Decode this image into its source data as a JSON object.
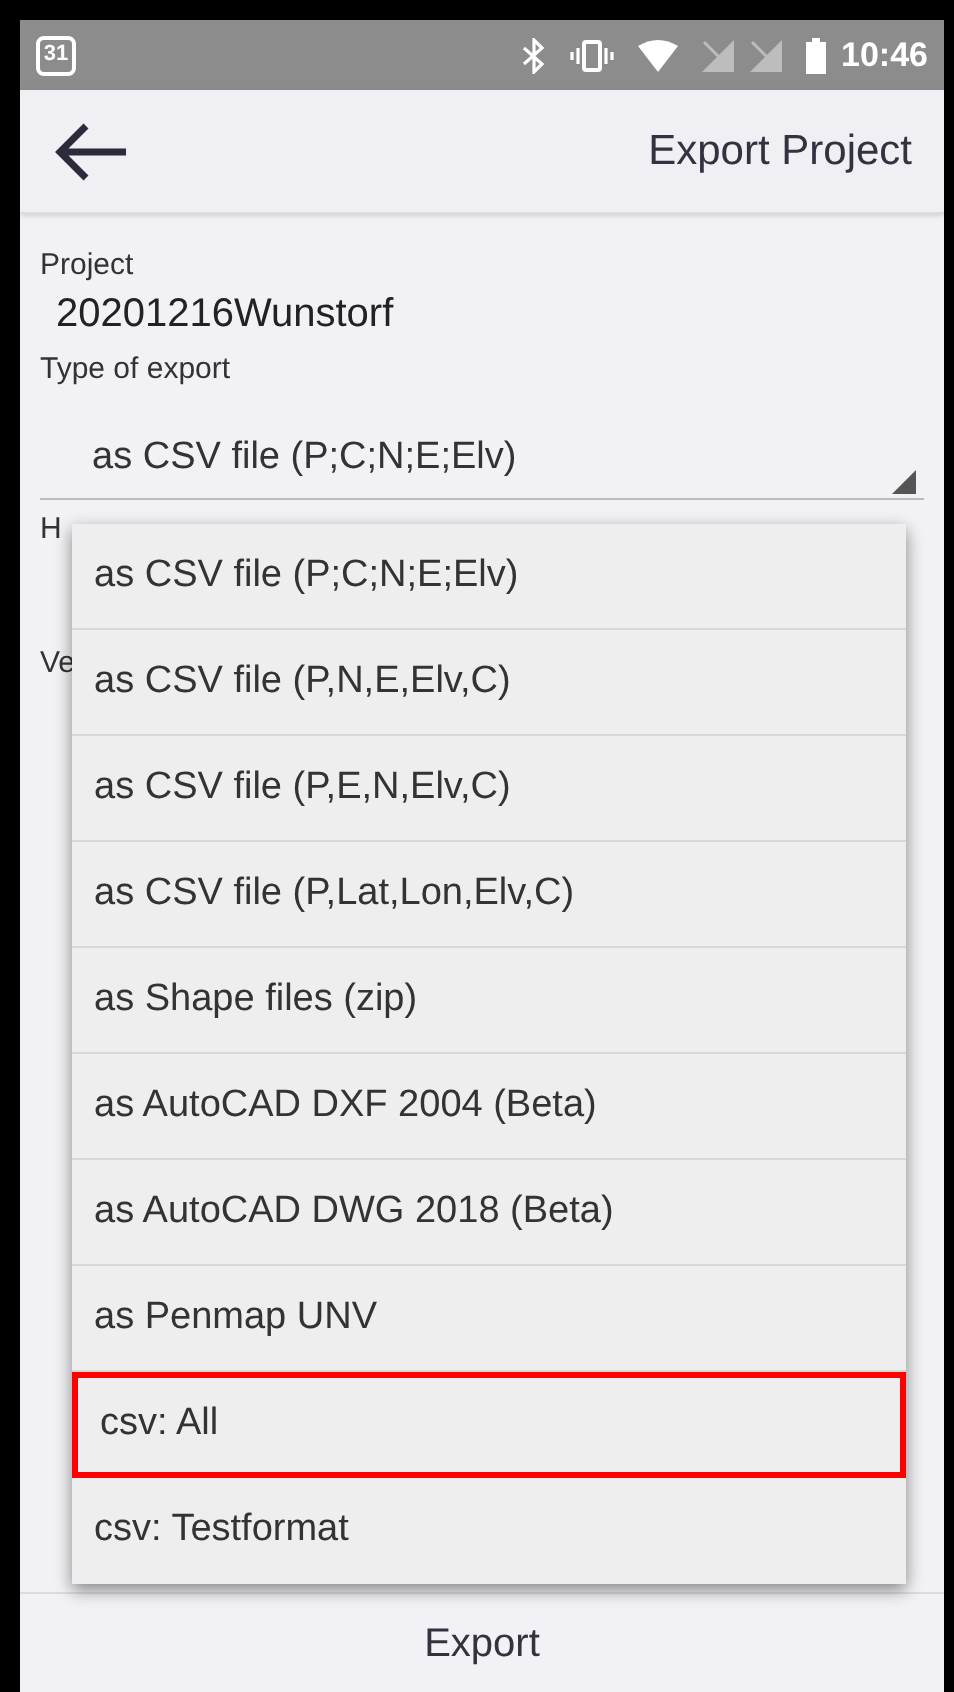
{
  "status_bar": {
    "time": "10:46",
    "calendar_day": "31"
  },
  "app_bar": {
    "title": "Export Project"
  },
  "form": {
    "project_label": "Project",
    "project_value": "20201216Wunstorf",
    "type_label": "Type of export",
    "type_value": "as CSV file (P;C;N;E;Elv)",
    "hidden_labels": [
      "H",
      "Ve"
    ]
  },
  "dropdown": {
    "options": [
      {
        "label": "as CSV file (P;C;N;E;Elv)",
        "highlighted": false
      },
      {
        "label": "as CSV file (P,N,E,Elv,C)",
        "highlighted": false
      },
      {
        "label": "as CSV file (P,E,N,Elv,C)",
        "highlighted": false
      },
      {
        "label": "as CSV file (P,Lat,Lon,Elv,C)",
        "highlighted": false
      },
      {
        "label": "as Shape files (zip)",
        "highlighted": false
      },
      {
        "label": "as AutoCAD DXF 2004 (Beta)",
        "highlighted": false
      },
      {
        "label": "as AutoCAD DWG 2018 (Beta)",
        "highlighted": false
      },
      {
        "label": "as Penmap UNV",
        "highlighted": false
      },
      {
        "label": "csv: All",
        "highlighted": true
      },
      {
        "label": "csv: Testformat",
        "highlighted": false
      }
    ]
  },
  "footer": {
    "button": "Export"
  }
}
